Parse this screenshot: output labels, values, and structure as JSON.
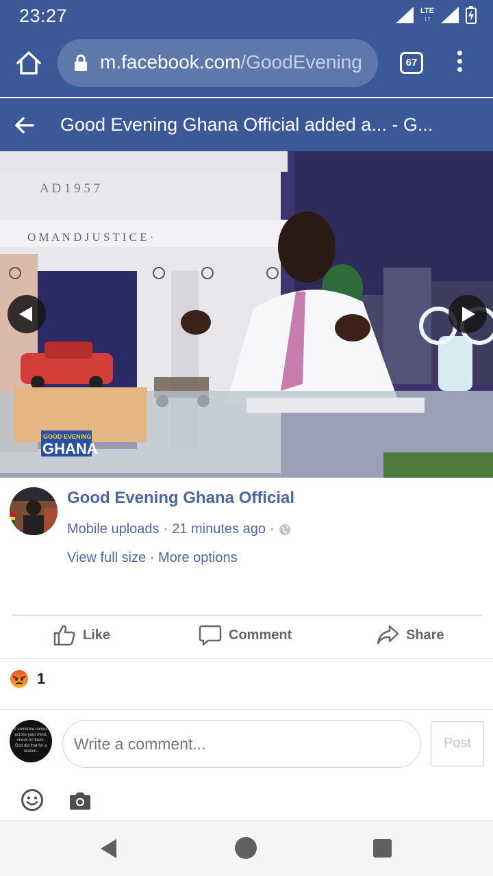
{
  "status_bar": {
    "time": "23:27",
    "network": "LTE",
    "network_arrows": "↓↑",
    "icons": [
      "signal-icon",
      "lte-icon",
      "signal-icon",
      "battery-charging-icon"
    ]
  },
  "browser": {
    "url_domain": "m.facebook.com",
    "url_path": "/GoodEvening",
    "tab_count": "67",
    "icons": [
      "home-icon",
      "lock-icon",
      "tabs-icon",
      "more-vert-icon"
    ]
  },
  "header": {
    "title": "Good Evening Ghana Official added a... - G...",
    "back_icon": "arrow-left-icon"
  },
  "photo": {
    "engraved_year": "A D 1 9 5 7",
    "engraved_motto": "O M   A N D   J U S T I C E ·",
    "logo_line1": "GOOD EVENING",
    "logo_line2": "GHANA",
    "prev_icon": "chevron-left-icon",
    "next_icon": "chevron-right-icon"
  },
  "post": {
    "page_name": "Good Evening Ghana Official",
    "album": "Mobile uploads",
    "separator": "·",
    "time_ago": "21 minutes ago",
    "privacy_icon": "globe-icon",
    "view_full_size": "View full size",
    "more_options": "More options"
  },
  "actions": {
    "like": "Like",
    "comment": "Comment",
    "share": "Share"
  },
  "reactions": {
    "icon": "angry-reaction-icon",
    "count": "1"
  },
  "comment_box": {
    "placeholder": "Write a comment...",
    "post_label": "Post",
    "avatar_text": "If someone comes across your mind, check on them. God did that for a reason.",
    "emoji_icon": "smiley-icon",
    "camera_icon": "camera-icon"
  },
  "nav_bar": {
    "icons": [
      "back-triangle-icon",
      "home-circle-icon",
      "recents-square-icon"
    ]
  },
  "colors": {
    "facebook_blue": "#3b5998",
    "link_blue": "#4b67a1",
    "gray_text": "#606770"
  }
}
